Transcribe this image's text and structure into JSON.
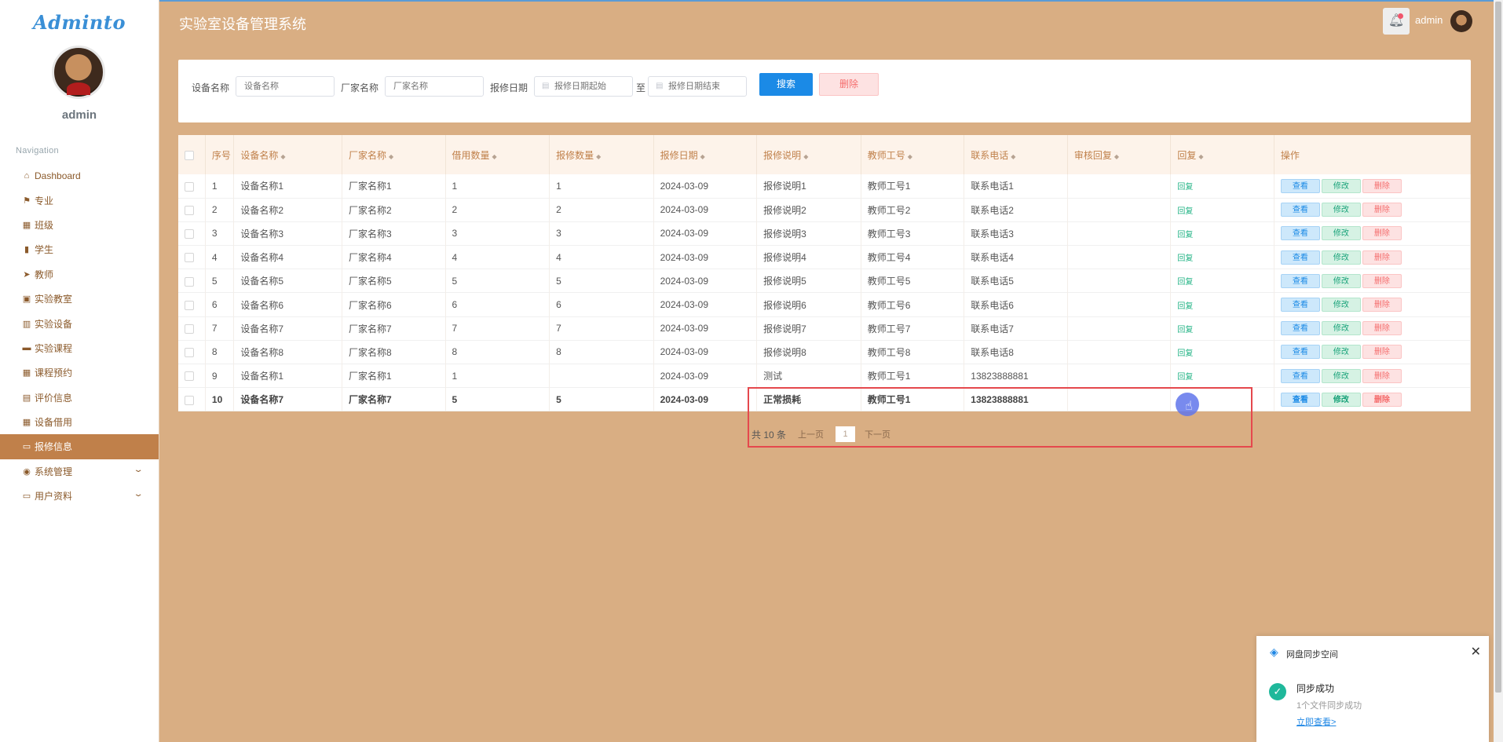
{
  "brand": "Adminto",
  "sidebar": {
    "user": "admin",
    "nav_title": "Navigation",
    "items": [
      {
        "label": "Dashboard",
        "icon": "⌂",
        "icon_name": "home-icon"
      },
      {
        "label": "专业",
        "icon": "⚑",
        "icon_name": "flag-icon"
      },
      {
        "label": "班级",
        "icon": "▦",
        "icon_name": "grid-icon"
      },
      {
        "label": "学生",
        "icon": "▮",
        "icon_name": "book-icon"
      },
      {
        "label": "教师",
        "icon": "➤",
        "icon_name": "send-icon"
      },
      {
        "label": "实验教室",
        "icon": "▣",
        "icon_name": "clipboard-icon"
      },
      {
        "label": "实验设备",
        "icon": "▥",
        "icon_name": "bar-chart-icon"
      },
      {
        "label": "实验课程",
        "icon": "▬",
        "icon_name": "briefcase-icon"
      },
      {
        "label": "课程预约",
        "icon": "▦",
        "icon_name": "grid-icon"
      },
      {
        "label": "评价信息",
        "icon": "▤",
        "icon_name": "list-icon"
      },
      {
        "label": "设备借用",
        "icon": "▦",
        "icon_name": "table-icon"
      },
      {
        "label": "报修信息",
        "icon": "▭",
        "icon_name": "monitor-icon"
      },
      {
        "label": "系统管理",
        "icon": "◉",
        "icon_name": "location-icon"
      },
      {
        "label": "用户资料",
        "icon": "▭",
        "icon_name": "id-card-icon"
      }
    ],
    "active_index": 11,
    "expandable": [
      12,
      13
    ]
  },
  "header": {
    "title": "实验室设备管理系统",
    "user": "admin"
  },
  "search": {
    "device_label": "设备名称",
    "device_placeholder": "设备名称",
    "maker_label": "厂家名称",
    "maker_placeholder": "厂家名称",
    "date_label": "报修日期",
    "date_start_placeholder": "报修日期起始",
    "date_sep": "至",
    "date_end_placeholder": "报修日期结束",
    "search_button": "搜索",
    "delete_button": "删除"
  },
  "table": {
    "columns": [
      "序号",
      "设备名称",
      "厂家名称",
      "借用数量",
      "报修数量",
      "报修日期",
      "报修说明",
      "教师工号",
      "联系电话",
      "审核回复",
      "回复",
      "操作"
    ],
    "reply_label": "回复",
    "ops": {
      "view": "查看",
      "edit": "修改",
      "delete": "删除"
    },
    "rows": [
      [
        "1",
        "设备名称1",
        "厂家名称1",
        "1",
        "1",
        "2024-03-09",
        "报修说明1",
        "教师工号1",
        "联系电话1",
        ""
      ],
      [
        "2",
        "设备名称2",
        "厂家名称2",
        "2",
        "2",
        "2024-03-09",
        "报修说明2",
        "教师工号2",
        "联系电话2",
        ""
      ],
      [
        "3",
        "设备名称3",
        "厂家名称3",
        "3",
        "3",
        "2024-03-09",
        "报修说明3",
        "教师工号3",
        "联系电话3",
        ""
      ],
      [
        "4",
        "设备名称4",
        "厂家名称4",
        "4",
        "4",
        "2024-03-09",
        "报修说明4",
        "教师工号4",
        "联系电话4",
        ""
      ],
      [
        "5",
        "设备名称5",
        "厂家名称5",
        "5",
        "5",
        "2024-03-09",
        "报修说明5",
        "教师工号5",
        "联系电话5",
        ""
      ],
      [
        "6",
        "设备名称6",
        "厂家名称6",
        "6",
        "6",
        "2024-03-09",
        "报修说明6",
        "教师工号6",
        "联系电话6",
        ""
      ],
      [
        "7",
        "设备名称7",
        "厂家名称7",
        "7",
        "7",
        "2024-03-09",
        "报修说明7",
        "教师工号7",
        "联系电话7",
        ""
      ],
      [
        "8",
        "设备名称8",
        "厂家名称8",
        "8",
        "8",
        "2024-03-09",
        "报修说明8",
        "教师工号8",
        "联系电话8",
        ""
      ],
      [
        "9",
        "设备名称1",
        "厂家名称1",
        "1",
        "",
        "2024-03-09",
        "测试",
        "教师工号1",
        "13823888881",
        ""
      ],
      [
        "10",
        "设备名称7",
        "厂家名称7",
        "5",
        "5",
        "2024-03-09",
        "正常损耗",
        "教师工号1",
        "13823888881",
        ""
      ]
    ],
    "bold_row_index": 9
  },
  "pager": {
    "total": "共 10 条",
    "prev": "上一页",
    "current": "1",
    "next": "下一页"
  },
  "toast": {
    "app": "网盘同步空间",
    "title": "同步成功",
    "subtitle": "1个文件同步成功",
    "link": "立即查看>"
  },
  "colors": {
    "background": "#d9ae83",
    "accent": "#c0804a",
    "primary_button": "#1b8ae6",
    "highlight_box": "#e5484d"
  }
}
